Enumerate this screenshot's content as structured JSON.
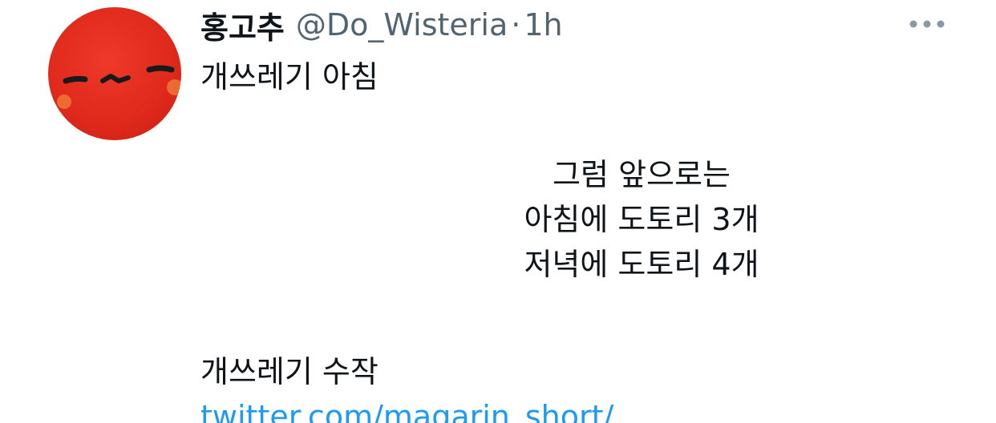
{
  "tweet": {
    "author": {
      "display_name": "홍고추",
      "handle": "@Do_Wisteria",
      "separator": "·",
      "time": "1h"
    },
    "more_icon": "more-horizontal-icon",
    "body": {
      "line1": "개쓰레기 아침",
      "centered_lines": [
        "그럼 앞으로는",
        "아침에 도토리 3개",
        "저녁에 도토리 4개"
      ],
      "closing_line": "개쓰레기 수작",
      "link_text": "twitter.com/magarin_short/"
    },
    "colors": {
      "text": "#0f1419",
      "secondary": "#536471",
      "link": "#1d9bf0",
      "avatar_red": "#e02a1c"
    }
  }
}
